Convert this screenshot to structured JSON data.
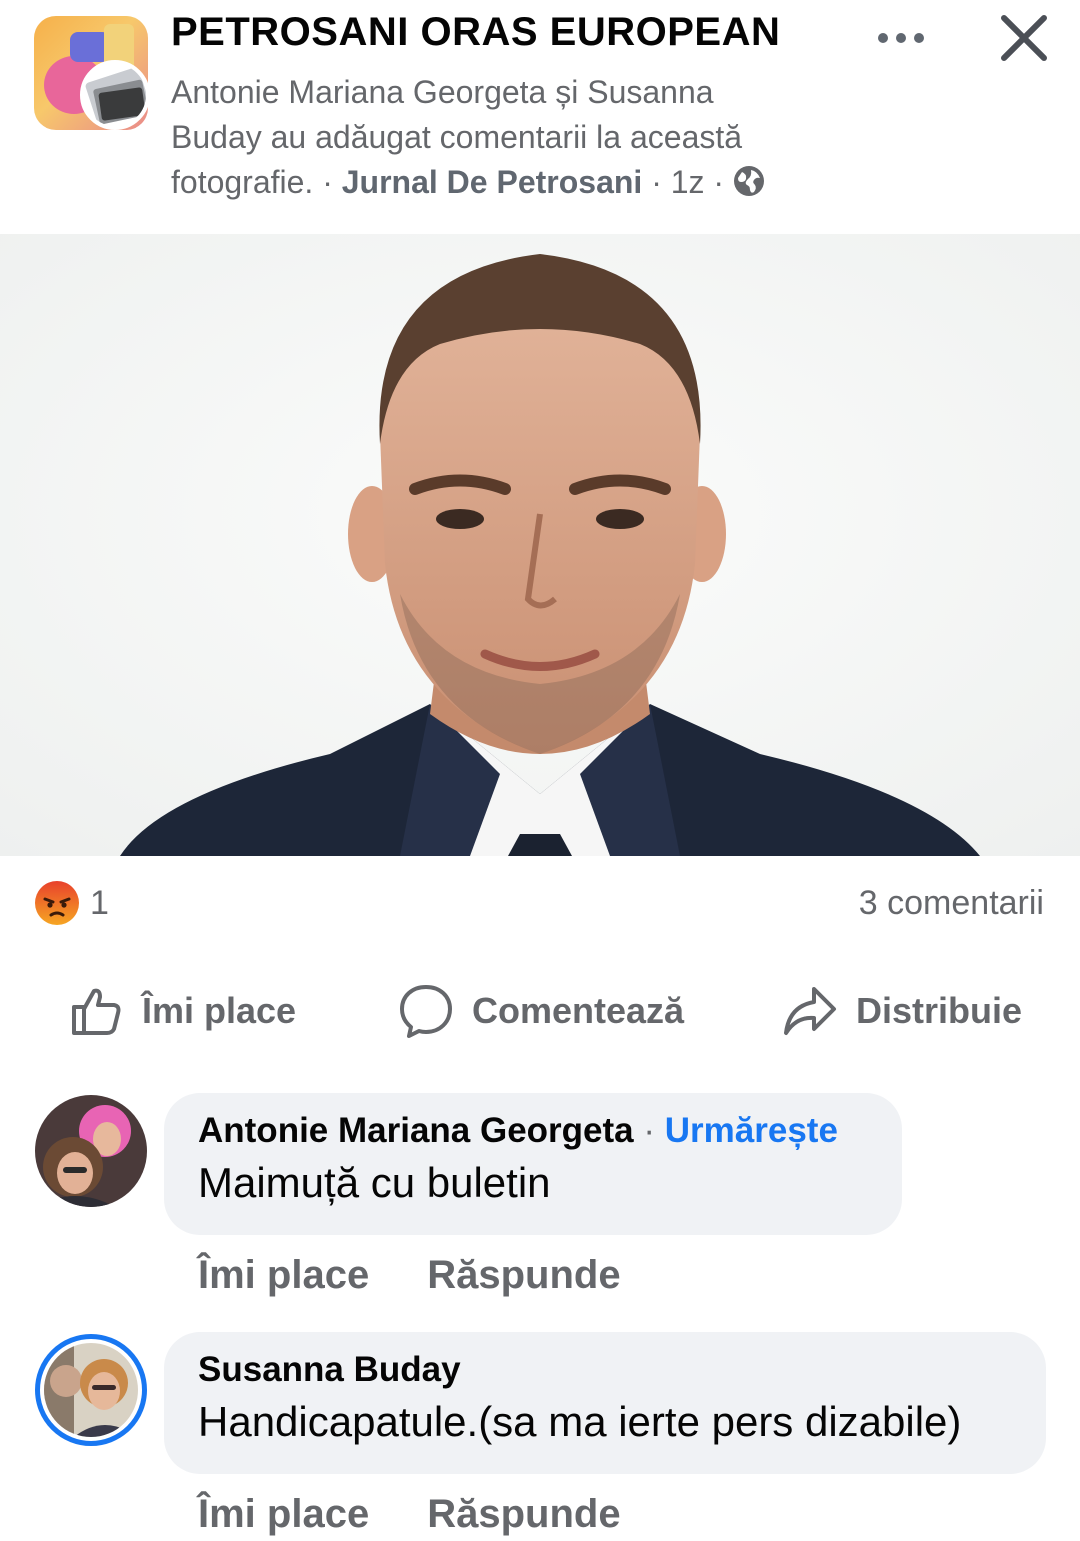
{
  "header": {
    "group_name": "PETROSANI ORAS EUROPEAN",
    "meta_prefix": "Antonie Mariana Georgeta și Susanna Buday au adăugat comentarii la această fotografie.",
    "separator": "·",
    "source_page": "Jurnal De Petrosani",
    "time_ago": "1z",
    "privacy_icon": "globe-icon",
    "more_icon": "more-dots-icon",
    "close_icon": "close-icon"
  },
  "photo": {
    "description_icon": "portrait-photo"
  },
  "reactions": {
    "reaction_icon": "angry-icon",
    "reaction_count": "1",
    "comments_label": "3 comentarii"
  },
  "actions": {
    "like_label": "Îmi place",
    "comment_label": "Comentează",
    "share_label": "Distribuie"
  },
  "comments": [
    {
      "author": "Antonie Mariana Georgeta",
      "follow_label": "Urmărește",
      "text": "Maimuță cu buletin",
      "like_label": "Îmi place",
      "reply_label": "Răspunde"
    },
    {
      "author": "Susanna Buday",
      "text": "Handicapatule.(sa ma ierte pers dizabile)",
      "like_label": "Îmi place",
      "reply_label": "Răspunde"
    }
  ],
  "colors": {
    "accent": "#1877f2",
    "secondary_text": "#65676b",
    "bubble_bg": "#f0f2f5",
    "angry": "#e9710f"
  }
}
